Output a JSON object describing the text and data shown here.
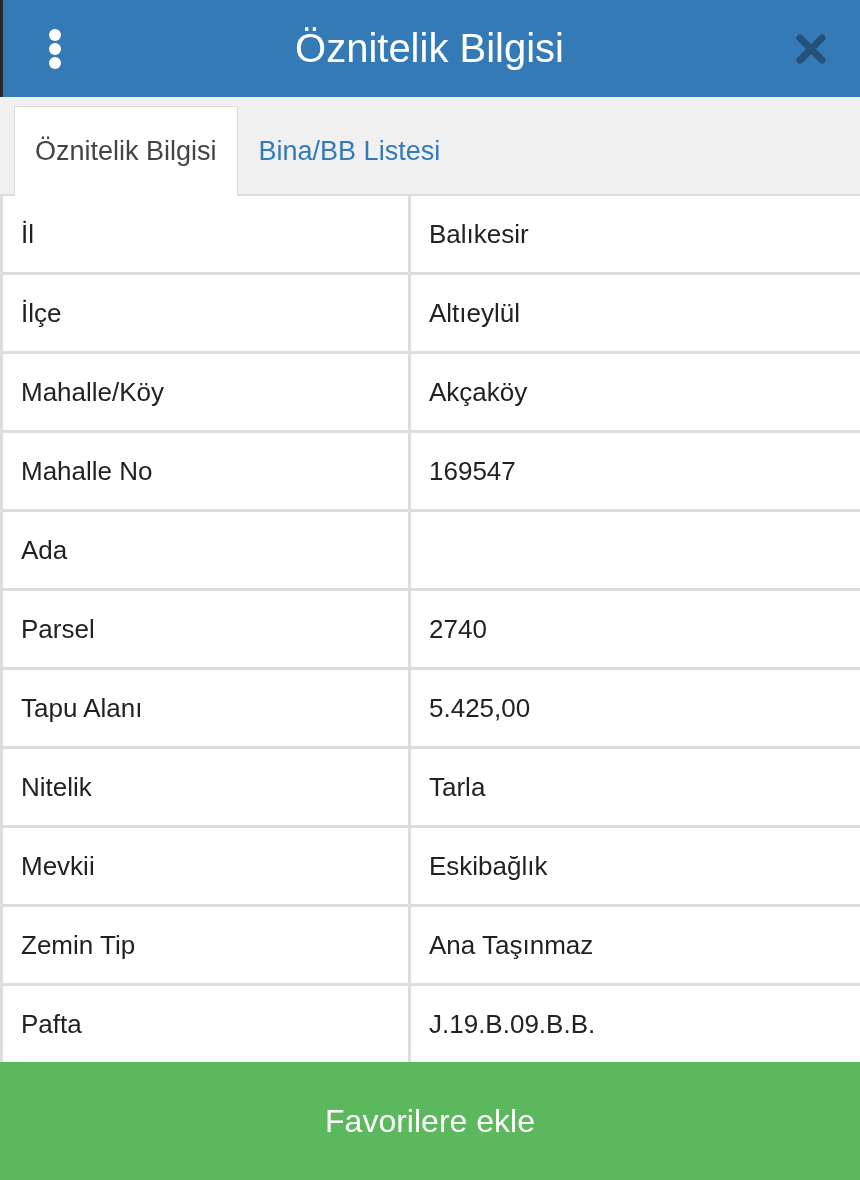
{
  "header": {
    "title": "Öznitelik Bilgisi"
  },
  "tabs": [
    {
      "label": "Öznitelik Bilgisi",
      "selected": true
    },
    {
      "label": "Bina/BB Listesi",
      "selected": false
    }
  ],
  "rows": [
    {
      "label": "İl",
      "value": "Balıkesir"
    },
    {
      "label": "İlçe",
      "value": "Altıeylül"
    },
    {
      "label": "Mahalle/Köy",
      "value": "Akçaköy"
    },
    {
      "label": "Mahalle No",
      "value": "169547"
    },
    {
      "label": "Ada"
    },
    {
      "label": "Parsel",
      "value": "2740"
    },
    {
      "label": "Tapu Alanı",
      "value": "5.425,00"
    },
    {
      "label": "Nitelik",
      "value": "Tarla"
    },
    {
      "label": "Mevkii",
      "value": "Eskibağlık"
    },
    {
      "label": "Zemin Tip",
      "value": "Ana Taşınmaz"
    },
    {
      "label": "Pafta",
      "value": "J.19.B.09.B.B."
    }
  ],
  "button": {
    "label": "Favorilere ekle"
  }
}
